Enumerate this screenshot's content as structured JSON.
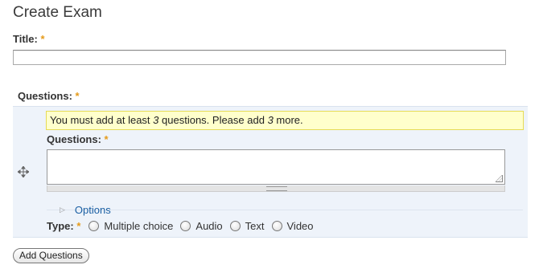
{
  "page": {
    "title": "Create Exam"
  },
  "title_field": {
    "label": "Title:",
    "required_mark": "*",
    "value": ""
  },
  "questions_section": {
    "label": "Questions:",
    "required_mark": "*",
    "warning": {
      "prefix": "You must add at least ",
      "min": "3",
      "middle": " questions. Please add ",
      "remaining": "3",
      "suffix": " more."
    },
    "question_field": {
      "label": "Questions:",
      "required_mark": "*",
      "value": ""
    },
    "options_link": "Options",
    "type": {
      "label": "Type:",
      "required_mark": "*",
      "options": [
        "Multiple choice",
        "Audio",
        "Text",
        "Video"
      ]
    }
  },
  "add_button": {
    "label": "Add Questions"
  },
  "colors": {
    "required": "#e59b1b",
    "link": "#1a5fa3",
    "warning_bg": "#ffffcc",
    "section_bg": "#eef3fa"
  },
  "icons": {
    "drag": "move-arrows-icon",
    "options": "triangle-right-icon"
  }
}
